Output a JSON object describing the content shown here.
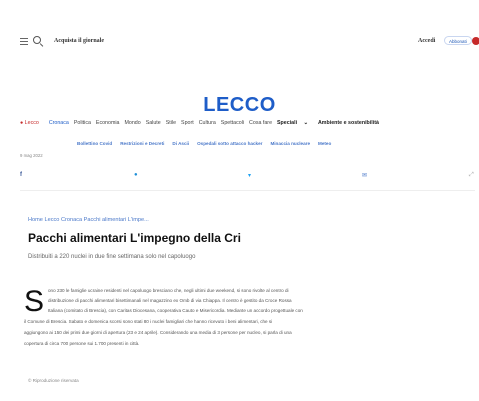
{
  "header": {
    "subscribe_text": "Acquista il giornale",
    "login_text": "Accedi",
    "subscribe_button": "Abbonati"
  },
  "logo": "LECCO",
  "nav": {
    "home": "Lecco",
    "active": "Cronaca",
    "items": [
      "Politica",
      "Economia",
      "Mondo",
      "Salute",
      "Stile",
      "Sport",
      "Cultura",
      "Spettacoli",
      "Cosa fare"
    ],
    "special": "Speciali",
    "last": "Ambiente e sostenibilità"
  },
  "subnav": [
    "Bollettino Covid",
    "Restrizioni e Decreti",
    "Di Ascii",
    "Ospedali sotto attacco hacker",
    "Minaccia nucleare",
    "Meteo"
  ],
  "date": "9 mag 2022",
  "article": {
    "breadcrumb": "Home  Lecco  Cronaca  Pacchi alimentari L'impe...",
    "title": "Pacchi alimentari L'impegno della Cri",
    "subtitle": "Distribuiti a 220 nuclei in due fine settimana solo nel capoluogo",
    "dropcap": "S",
    "lines": [
      "ono 230 le famiglie ucraine residenti nel capoluogo bresciano che, negli ultimi due weekend, si sono rivolte al centro di",
      "distribuzione di pacchi alimentari bisettimanali nel magazzino ex Omb di via Chiappa. Il centro è gestito da Croce Rossa",
      "Italiana (comitato di Brescia), con Caritas Diocesana, cooperativa Cauto e Misericordia. Mediante un accordo progettuale con",
      "il Comune di Brescia. Sabato e domenica scorsi sono stati 80 i nuclei famigliari che hanno ricevuto i beni alimentari, che si",
      "aggiungono ai 150 dei primi due giorni di apertura (23 e 24 aprile). Considerando una media di 3 persone per nucleo, si parla di una",
      "copertura di circa 700 persone sui 1.700 presenti in città."
    ]
  },
  "copyright": "© Riproduzione riservata",
  "colors": {
    "brand_blue": "#1e5dc8",
    "accent_red": "#c62a2a",
    "link_blue": "#4a78c9"
  },
  "icons": {
    "share": [
      "facebook-icon",
      "whatsapp-icon",
      "twitter-icon",
      "email-icon",
      "link-icon"
    ]
  }
}
